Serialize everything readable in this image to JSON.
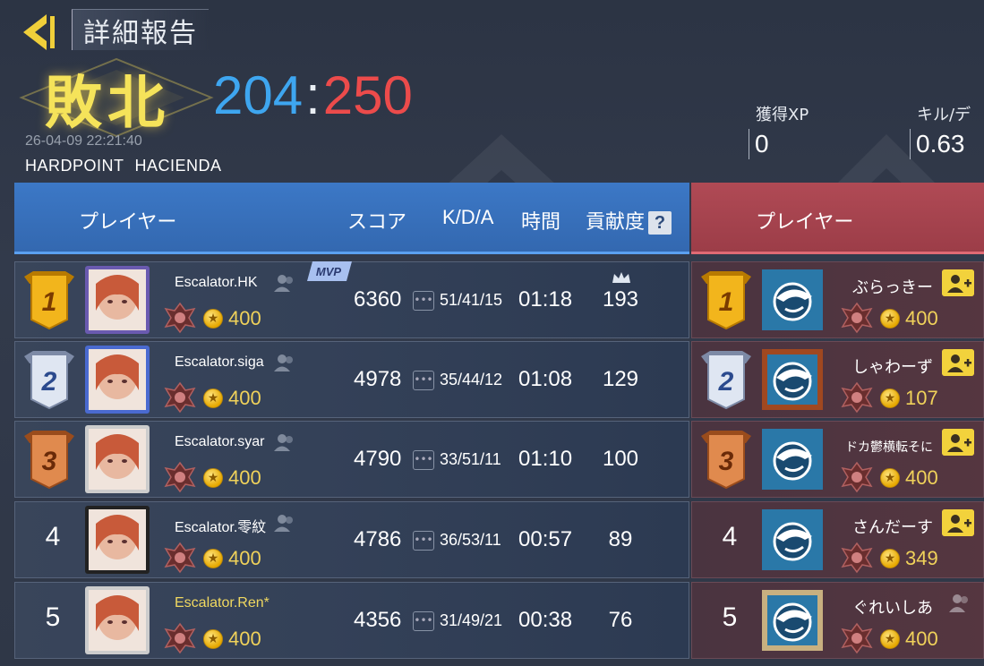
{
  "header": {
    "title": "詳細報告",
    "result": "敗北",
    "score_blue": "204",
    "score_separator": ":",
    "score_red": "250",
    "datetime": "26-04-09 22:21:40",
    "mode": "HARDPOINT",
    "map": "HACIENDA"
  },
  "stats": [
    {
      "label": "獲得XP",
      "value": "0"
    },
    {
      "label": "キル/デ",
      "value": "0.63"
    }
  ],
  "columns": {
    "player": "プレイヤー",
    "score": "スコア",
    "kda": "K/D/A",
    "time": "時間",
    "contribution": "貢献度",
    "help": "?",
    "enemy_player": "プレイヤー"
  },
  "mvp_label": "MVP",
  "ally_rows": [
    {
      "rank": "1",
      "name": "Escalator.HK",
      "coins": "400",
      "score": "6360",
      "kda": "51/41/15",
      "time": "01:18",
      "contribution": "193"
    },
    {
      "rank": "2",
      "name": "Escalator.siga",
      "coins": "400",
      "score": "4978",
      "kda": "35/44/12",
      "time": "01:08",
      "contribution": "129"
    },
    {
      "rank": "3",
      "name": "Escalator.syar",
      "coins": "400",
      "score": "4790",
      "kda": "33/51/11",
      "time": "01:10",
      "contribution": "100"
    },
    {
      "rank": "4",
      "name": "Escalator.零紋",
      "coins": "400",
      "score": "4786",
      "kda": "36/53/11",
      "time": "00:57",
      "contribution": "89"
    },
    {
      "rank": "5",
      "name": "Escalator.Ren*",
      "coins": "400",
      "score": "4356",
      "kda": "31/49/21",
      "time": "00:38",
      "contribution": "76"
    }
  ],
  "enemy_rows": [
    {
      "rank": "1",
      "name": "ぶらっきー",
      "coins": "400"
    },
    {
      "rank": "2",
      "name": "しゃわーず",
      "coins": "107"
    },
    {
      "rank": "3",
      "name": "ドカ鬱横転そに",
      "coins": "400"
    },
    {
      "rank": "4",
      "name": "さんだーす",
      "coins": "349"
    },
    {
      "rank": "5",
      "name": "ぐれいしあ",
      "coins": "400"
    }
  ],
  "colors": {
    "ally_blue": "#3ea6f0",
    "enemy_red": "#ec4b4b",
    "defeat_gold": "#f5e35a",
    "coin_gold": "#f0d25a"
  }
}
